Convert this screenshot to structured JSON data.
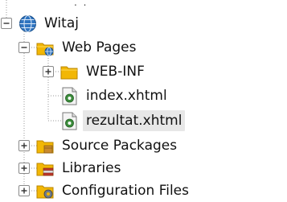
{
  "top_fragment": ". .",
  "tree": {
    "nodes": [
      {
        "label": "Witaj",
        "icon": "globe-icon",
        "toggle": "expanded"
      },
      {
        "label": "Web Pages",
        "icon": "web-pages-folder-icon",
        "toggle": "expanded"
      },
      {
        "label": "WEB-INF",
        "icon": "folder-icon",
        "toggle": "collapsed"
      },
      {
        "label": "index.xhtml",
        "icon": "xhtml-file-icon",
        "toggle": "none"
      },
      {
        "label": "rezultat.xhtml",
        "icon": "xhtml-file-icon",
        "toggle": "none",
        "selected": true
      },
      {
        "label": "Source Packages",
        "icon": "source-packages-icon",
        "toggle": "collapsed"
      },
      {
        "label": "Libraries",
        "icon": "libraries-icon",
        "toggle": "collapsed"
      },
      {
        "label": "Configuration Files",
        "icon": "configuration-files-icon",
        "toggle": "collapsed"
      }
    ]
  },
  "colors": {
    "selection": "#e7e7e7",
    "folder_yellow": "#f2b705",
    "globe_blue": "#2f74c0",
    "file_green": "#3b8c3b",
    "tree_lines": "#999999"
  }
}
